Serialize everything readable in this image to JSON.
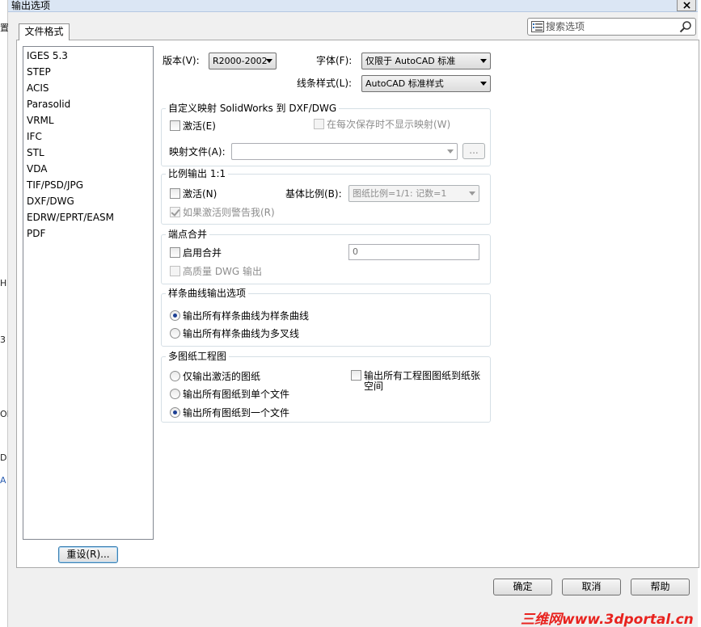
{
  "window": {
    "title": "输出选项"
  },
  "search": {
    "placeholder": "搜索选项"
  },
  "tabs": [
    {
      "label": "文件格式"
    }
  ],
  "file_formats": [
    "IGES 5.3",
    "STEP",
    "ACIS",
    "Parasolid",
    "VRML",
    "IFC",
    "STL",
    "VDA",
    "TIF/PSD/JPG",
    "DXF/DWG",
    "EDRW/EPRT/EASM",
    "PDF"
  ],
  "reset_button": "重设(R)...",
  "version": {
    "label": "版本(V):",
    "value": "R2000-2002"
  },
  "font": {
    "label": "字体(F):",
    "value": "仅限于 AutoCAD 标准"
  },
  "line_style": {
    "label": "线条样式(L):",
    "value": "AutoCAD 标准样式"
  },
  "custom_map": {
    "title": "自定义映射 SolidWorks 到 DXF/DWG",
    "activate": "激活(E)",
    "no_show": "在每次保存时不显示映射(W)",
    "map_file_label": "映射文件(A):",
    "map_file_value": "",
    "browse": "..."
  },
  "scale": {
    "title": "比例输出 1:1",
    "activate": "激活(N)",
    "base_scale_label": "基体比例(B):",
    "base_scale_value": "图纸比例=1/1: 记数=1",
    "warn": "如果激活则警告我(R)"
  },
  "merge": {
    "title": "端点合并",
    "enable": "启用合并",
    "value": "0",
    "hq": "高质量 DWG 输出"
  },
  "spline": {
    "title": "样条曲线输出选项",
    "options": [
      "输出所有样条曲线为样条曲线",
      "输出所有样条曲线为多叉线"
    ]
  },
  "multi_sheet": {
    "title": "多图纸工程图",
    "options": [
      "仅输出激活的图纸",
      "输出所有图纸到单个文件",
      "输出所有图纸到一个文件"
    ],
    "paper_space_line1": "输出所有工程图图纸到纸张",
    "paper_space_line2": "空间"
  },
  "footer": {
    "ok": "确定",
    "cancel": "取消",
    "help": "帮助"
  },
  "left_fragments": [
    "置",
    "H",
    "3",
    "OF",
    "D",
    "A"
  ],
  "watermark": "三维网www.3dportal.cn",
  "colors": {
    "radio_dot": "#1c3f94",
    "titlebar": "#dbe6f4",
    "watermark": "#e8231f"
  }
}
